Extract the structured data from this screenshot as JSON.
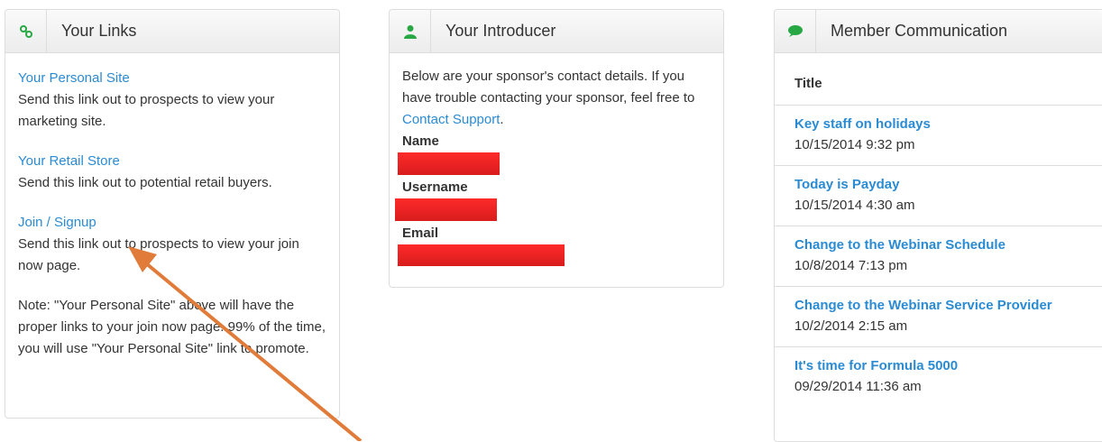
{
  "links_panel": {
    "title": "Your Links",
    "icon": "link-icon",
    "items": [
      {
        "label": "Your Personal Site",
        "description": "Send this link out to prospects to view your marketing site."
      },
      {
        "label": "Your Retail Store",
        "description": "Send this link out to potential retail buyers."
      },
      {
        "label": "Join / Signup",
        "description": "Send this link out to prospects to view your join now page."
      }
    ],
    "note": "Note: \"Your Personal Site\" above will have the proper links to your join now page. 99% of the time, you will use \"Your Personal Site\" link to promote."
  },
  "introducer_panel": {
    "title": "Your Introducer",
    "icon": "user-icon",
    "intro_text": "Below are your sponsor's contact details. If you have trouble contacting your sponsor, feel free to",
    "support_link": "Contact Support",
    "fields": [
      {
        "label": "Name"
      },
      {
        "label": "Username"
      },
      {
        "label": "Email"
      }
    ]
  },
  "communication_panel": {
    "title": "Member Communication",
    "icon": "comment-icon",
    "column_header": "Title",
    "messages": [
      {
        "title": "Key staff on holidays",
        "date": "10/15/2014 9:32 pm"
      },
      {
        "title": "Today is Payday",
        "date": "10/15/2014 4:30 am"
      },
      {
        "title": "Change to the Webinar Schedule",
        "date": "10/8/2014 7:13 pm"
      },
      {
        "title": "Change to the Webinar Service Provider",
        "date": "10/2/2014 2:15 am"
      },
      {
        "title": "It's time for Formula 5000",
        "date": "09/29/2014 11:36 am"
      }
    ]
  },
  "colors": {
    "link": "#2a8bd3",
    "icon_green": "#27a844",
    "redaction": "#e82222",
    "annotation_arrow": "#e07b39"
  }
}
